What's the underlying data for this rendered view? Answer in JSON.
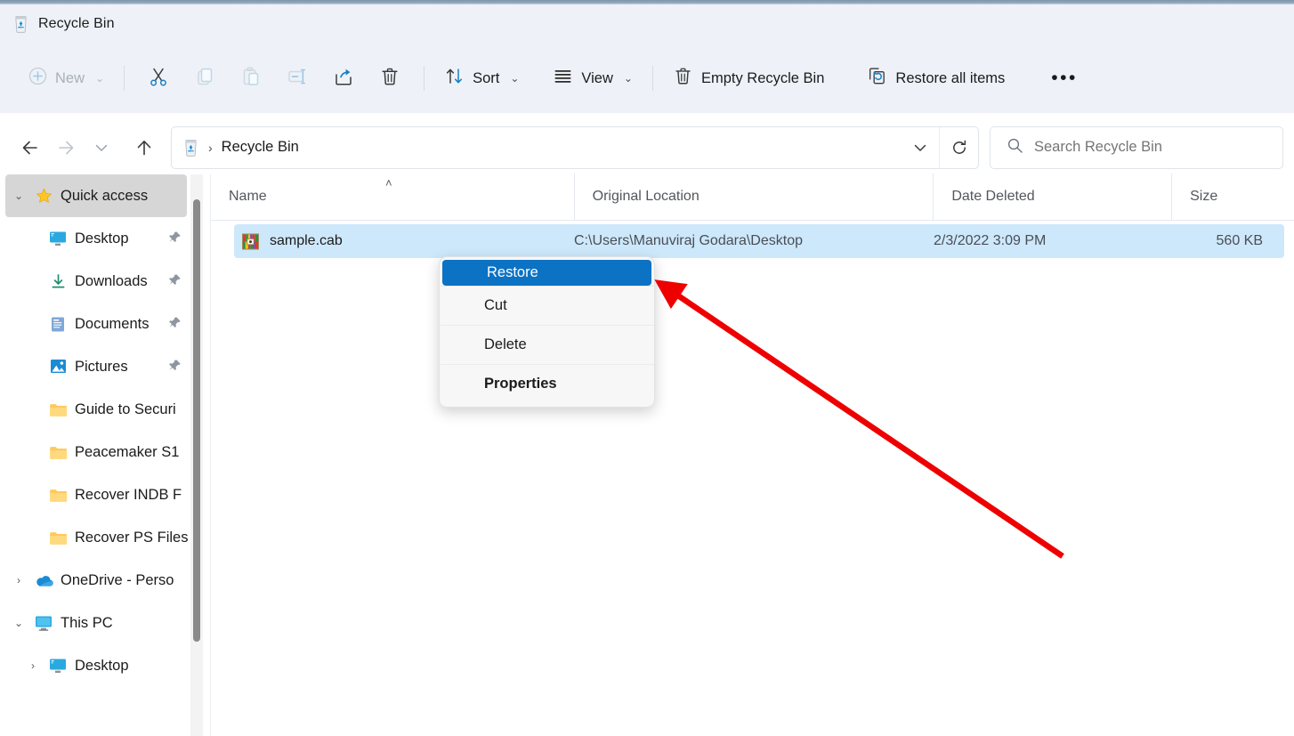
{
  "window": {
    "title": "Recycle Bin",
    "title_icon": "recycle-bin-icon"
  },
  "toolbar": {
    "new_label": "New",
    "new_icon": "plus-circle-icon",
    "cut_icon": "scissors-icon",
    "copy_icon": "copy-icon",
    "paste_icon": "paste-icon",
    "rename_icon": "rename-icon",
    "share_icon": "share-icon",
    "delete_icon": "trash-icon",
    "sort_label": "Sort",
    "sort_icon": "sort-arrows-icon",
    "view_label": "View",
    "view_icon": "list-lines-icon",
    "empty_label": "Empty Recycle Bin",
    "empty_icon": "trash-icon",
    "restore_all_label": "Restore all items",
    "restore_all_icon": "restore-arrow-icon",
    "overflow_label": "•••",
    "chevron": "⌄"
  },
  "addressbar": {
    "back_icon": "arrow-left-icon",
    "forward_icon": "arrow-right-icon",
    "history_icon": "chevron-down-icon",
    "up_icon": "arrow-up-icon",
    "crumb_icon": "recycle-bin-icon",
    "crumb_separator": "›",
    "crumb_label": "Recycle Bin",
    "dropdown_icon": "chevron-down-icon",
    "refresh_icon": "refresh-icon"
  },
  "search": {
    "icon": "search-icon",
    "placeholder": "Search Recycle Bin",
    "value": ""
  },
  "sidebar": {
    "items": [
      {
        "label": "Quick access",
        "icon": "star-icon",
        "twisty": "⌄",
        "indent": 0,
        "pinned": false,
        "selected": true
      },
      {
        "label": "Desktop",
        "icon": "desktop-icon",
        "twisty": "",
        "indent": 1,
        "pinned": true,
        "selected": false
      },
      {
        "label": "Downloads",
        "icon": "download-icon",
        "twisty": "",
        "indent": 1,
        "pinned": true,
        "selected": false
      },
      {
        "label": "Documents",
        "icon": "document-icon",
        "twisty": "",
        "indent": 1,
        "pinned": true,
        "selected": false
      },
      {
        "label": "Pictures",
        "icon": "picture-icon",
        "twisty": "",
        "indent": 1,
        "pinned": true,
        "selected": false
      },
      {
        "label": "Guide to Securi",
        "icon": "folder-icon",
        "twisty": "",
        "indent": 1,
        "pinned": false,
        "selected": false
      },
      {
        "label": "Peacemaker S1",
        "icon": "folder-icon",
        "twisty": "",
        "indent": 1,
        "pinned": false,
        "selected": false
      },
      {
        "label": "Recover INDB F",
        "icon": "folder-icon",
        "twisty": "",
        "indent": 1,
        "pinned": false,
        "selected": false
      },
      {
        "label": "Recover PS Files",
        "icon": "folder-icon",
        "twisty": "",
        "indent": 1,
        "pinned": false,
        "selected": false
      },
      {
        "label": "OneDrive - Perso",
        "icon": "onedrive-icon",
        "twisty": "›",
        "indent": 0,
        "pinned": false,
        "selected": false
      },
      {
        "label": "This PC",
        "icon": "pc-icon",
        "twisty": "⌄",
        "indent": 0,
        "pinned": false,
        "selected": false
      },
      {
        "label": "Desktop",
        "icon": "desktop-icon",
        "twisty": "›",
        "indent": 1,
        "pinned": false,
        "selected": false
      }
    ]
  },
  "filelist": {
    "columns": [
      {
        "label": "Name",
        "sorted": "ascending",
        "sort_caret": "˄"
      },
      {
        "label": "Original Location",
        "sorted": "",
        "sort_caret": ""
      },
      {
        "label": "Date Deleted",
        "sorted": "",
        "sort_caret": ""
      },
      {
        "label": "Size",
        "sorted": "",
        "sort_caret": ""
      }
    ],
    "rows": [
      {
        "name": "sample.cab",
        "icon": "cab-archive-icon",
        "original_location": "C:\\Users\\Manuviraj Godara\\Desktop",
        "date_deleted": "2/3/2022 3:09 PM",
        "size": "560 KB",
        "selected": true
      }
    ]
  },
  "context_menu": {
    "items": [
      {
        "label": "Restore",
        "highlighted": true,
        "bold": false
      },
      {
        "label": "Cut",
        "highlighted": false,
        "bold": false
      },
      {
        "label": "Delete",
        "highlighted": false,
        "bold": false
      },
      {
        "label": "Properties",
        "highlighted": false,
        "bold": true
      }
    ]
  },
  "annotation": {
    "arrow_color": "#ee0000",
    "points_to": "Restore"
  },
  "colors": {
    "accent_blue": "#0b72c4",
    "chrome_bg": "#eef2f8",
    "row_selected": "#cde8fb",
    "nav_selected": "#d6d6d6",
    "annotation_red": "#ee0000"
  }
}
